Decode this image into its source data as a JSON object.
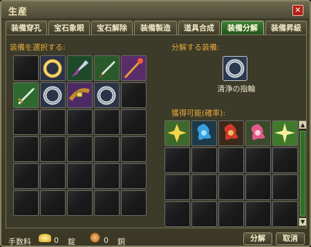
{
  "window": {
    "title": "生産",
    "close_glyph": "✕"
  },
  "tabs": [
    {
      "label": "装備穿孔",
      "active": false
    },
    {
      "label": "宝石象眼",
      "active": false
    },
    {
      "label": "宝石解除",
      "active": false
    },
    {
      "label": "装備製造",
      "active": false
    },
    {
      "label": "道具合成",
      "active": false
    },
    {
      "label": "装備分解",
      "active": true
    },
    {
      "label": "装備昇級",
      "active": false
    }
  ],
  "left": {
    "label": "装備を選択する:",
    "items": [
      "empty",
      "ring-gold-icon",
      "feather-wing-icon",
      "dagger-green-icon",
      "staff-icon",
      "sword-icon",
      "ring-silver-icon",
      "belt-icon",
      "ring-silver-icon",
      "empty"
    ]
  },
  "right": {
    "target_label": "分解する装備:",
    "target_icon": "ring-silver-icon",
    "target_name": "清浄の指輪",
    "result_label": "獲得可能(確率):",
    "results": [
      "star-yellow-icon",
      "shuriken-blue-icon",
      "shuriken-red-icon",
      "shuriken-pink-icon",
      "star-green-icon"
    ]
  },
  "footer": {
    "fee_label": "手数料",
    "gold_value": "0",
    "gold_unit": "錠",
    "copper_value": "0",
    "copper_unit": "銅",
    "decompose_button": "分解",
    "cancel_button": "取消"
  },
  "colors": {
    "accent": "#e7a93c",
    "tab_active": "#3e7f34"
  }
}
